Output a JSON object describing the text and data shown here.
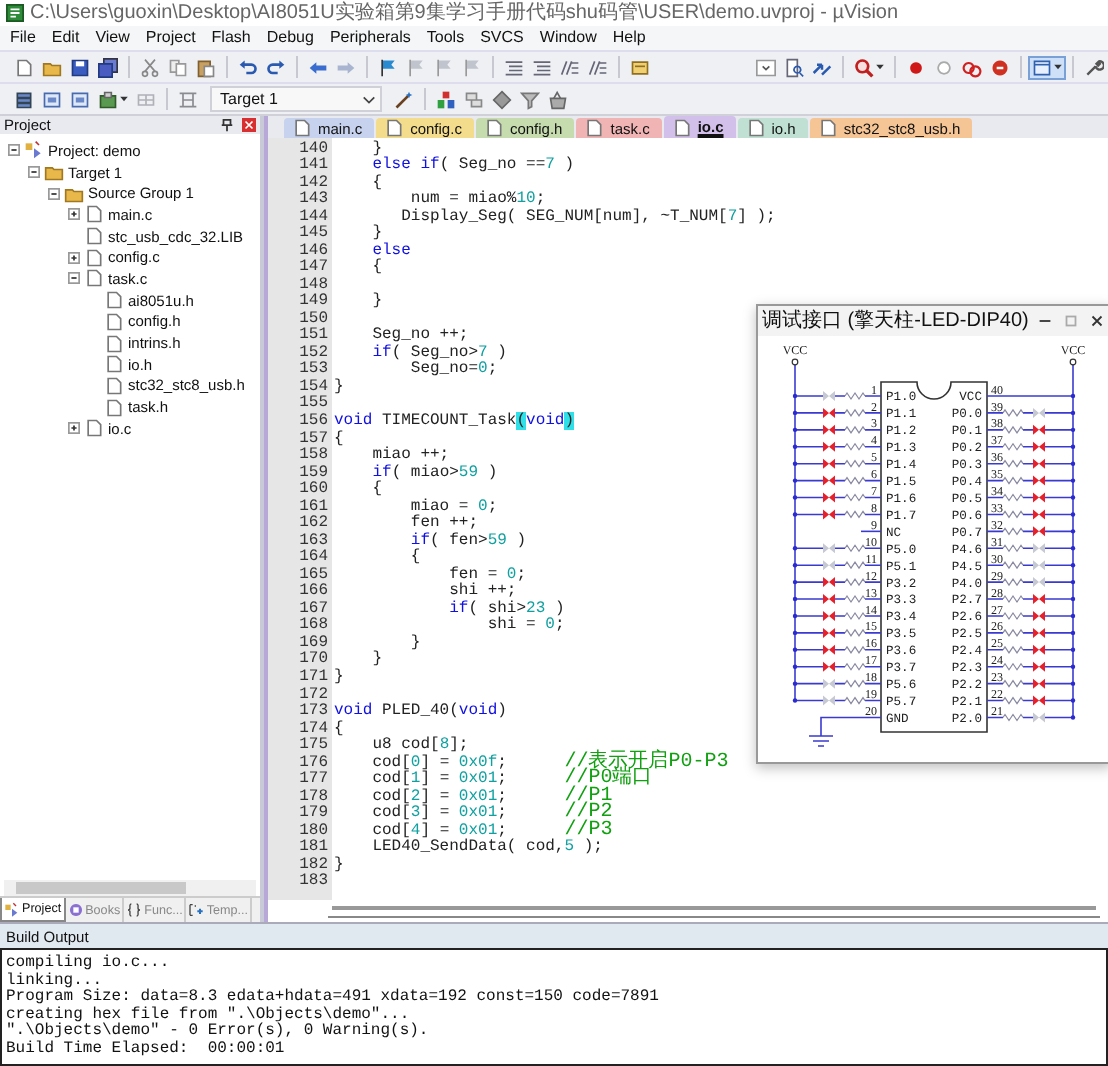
{
  "window": {
    "title": "C:\\Users\\guoxin\\Desktop\\AI8051U实验箱第9集学习手册代码shu码管\\USER\\demo.uvproj - µVision"
  },
  "menu": [
    "File",
    "Edit",
    "View",
    "Project",
    "Flash",
    "Debug",
    "Peripherals",
    "Tools",
    "SVCS",
    "Window",
    "Help"
  ],
  "target_select": {
    "value": "Target 1"
  },
  "project": {
    "title": "Project",
    "tree": [
      {
        "label": "Project: demo",
        "kind": "project",
        "expanded": true,
        "children": [
          {
            "label": "Target 1",
            "kind": "target",
            "expanded": true,
            "children": [
              {
                "label": "Source Group 1",
                "kind": "group",
                "expanded": true,
                "children": [
                  {
                    "label": "main.c",
                    "kind": "file",
                    "expanded": false
                  },
                  {
                    "label": "stc_usb_cdc_32.LIB",
                    "kind": "file"
                  },
                  {
                    "label": "config.c",
                    "kind": "file",
                    "expanded": false
                  },
                  {
                    "label": "task.c",
                    "kind": "file",
                    "expanded": true,
                    "children": [
                      {
                        "label": "ai8051u.h",
                        "kind": "file"
                      },
                      {
                        "label": "config.h",
                        "kind": "file"
                      },
                      {
                        "label": "intrins.h",
                        "kind": "file"
                      },
                      {
                        "label": "io.h",
                        "kind": "file"
                      },
                      {
                        "label": "stc32_stc8_usb.h",
                        "kind": "file"
                      },
                      {
                        "label": "task.h",
                        "kind": "file"
                      }
                    ]
                  },
                  {
                    "label": "io.c",
                    "kind": "file",
                    "expanded": false
                  }
                ]
              }
            ]
          }
        ]
      }
    ],
    "panel_tabs": [
      {
        "label": "Project",
        "kind": "project",
        "selected": true
      },
      {
        "label": "Books",
        "kind": "books",
        "selected": false
      },
      {
        "label": "Func...",
        "kind": "functions",
        "selected": false
      },
      {
        "label": "Temp...",
        "kind": "templates",
        "selected": false
      }
    ]
  },
  "editor": {
    "tabs": [
      {
        "label": "main.c",
        "color": "#c6d2ee",
        "selected": false
      },
      {
        "label": "config.c",
        "color": "#f3dc8c",
        "selected": false
      },
      {
        "label": "config.h",
        "color": "#c6dcae",
        "selected": false
      },
      {
        "label": "task.c",
        "color": "#f0b4b4",
        "selected": false
      },
      {
        "label": "io.c",
        "color": "#d2c0ea",
        "selected": true
      },
      {
        "label": "io.h",
        "color": "#bfe0d2",
        "selected": false
      },
      {
        "label": "stc32_stc8_usb.h",
        "color": "#f6c595",
        "selected": false
      }
    ],
    "lines": [
      {
        "number": "140",
        "segments": [
          {
            "kind": "plain",
            "text": "    }"
          }
        ]
      },
      {
        "number": "141",
        "segments": [
          {
            "kind": "keyword",
            "text": "    else if"
          },
          {
            "kind": "plain",
            "text": "( Seg_no =="
          },
          {
            "kind": "number",
            "text": "7"
          },
          {
            "kind": "plain",
            "text": " )"
          }
        ]
      },
      {
        "number": "142",
        "segments": [
          {
            "kind": "plain",
            "text": "    {"
          }
        ]
      },
      {
        "number": "143",
        "segments": [
          {
            "kind": "plain",
            "text": "        num = miao%"
          },
          {
            "kind": "number",
            "text": "10"
          },
          {
            "kind": "plain",
            "text": ";"
          }
        ]
      },
      {
        "number": "144",
        "segments": [
          {
            "kind": "plain",
            "text": "       Display_Seg( SEG_NUM[num], ~T_NUM["
          },
          {
            "kind": "number",
            "text": "7"
          },
          {
            "kind": "plain",
            "text": "] );"
          }
        ]
      },
      {
        "number": "145",
        "segments": [
          {
            "kind": "plain",
            "text": "    }"
          }
        ]
      },
      {
        "number": "146",
        "segments": [
          {
            "kind": "keyword",
            "text": "    else"
          }
        ]
      },
      {
        "number": "147",
        "segments": [
          {
            "kind": "plain",
            "text": "    {"
          }
        ]
      },
      {
        "number": "148"
      },
      {
        "number": "149",
        "segments": [
          {
            "kind": "plain",
            "text": "    }"
          }
        ]
      },
      {
        "number": "150"
      },
      {
        "number": "151",
        "segments": [
          {
            "kind": "plain",
            "text": "    Seg_no ++;"
          }
        ]
      },
      {
        "number": "152",
        "segments": [
          {
            "kind": "keyword",
            "text": "    if"
          },
          {
            "kind": "plain",
            "text": "( Seg_no>"
          },
          {
            "kind": "number",
            "text": "7"
          },
          {
            "kind": "plain",
            "text": " )"
          }
        ]
      },
      {
        "number": "153",
        "segments": [
          {
            "kind": "plain",
            "text": "        Seg_no="
          },
          {
            "kind": "number",
            "text": "0"
          },
          {
            "kind": "plain",
            "text": ";"
          }
        ]
      },
      {
        "number": "154",
        "segments": [
          {
            "kind": "plain",
            "text": "}"
          }
        ]
      },
      {
        "number": "155"
      },
      {
        "number": "156",
        "segments": [
          {
            "kind": "keyword",
            "text": "void"
          },
          {
            "kind": "plain",
            "text": " TIMECOUNT_Task"
          },
          {
            "kind": "match",
            "text": "("
          },
          {
            "kind": "keyword",
            "text": "void"
          },
          {
            "kind": "match",
            "text": ")"
          }
        ]
      },
      {
        "number": "157",
        "segments": [
          {
            "kind": "plain",
            "text": "{"
          }
        ]
      },
      {
        "number": "158",
        "segments": [
          {
            "kind": "plain",
            "text": "    miao ++;"
          }
        ]
      },
      {
        "number": "159",
        "segments": [
          {
            "kind": "keyword",
            "text": "    if"
          },
          {
            "kind": "plain",
            "text": "( miao>"
          },
          {
            "kind": "number",
            "text": "59"
          },
          {
            "kind": "plain",
            "text": " )"
          }
        ]
      },
      {
        "number": "160",
        "segments": [
          {
            "kind": "plain",
            "text": "    {"
          }
        ]
      },
      {
        "number": "161",
        "segments": [
          {
            "kind": "plain",
            "text": "        miao = "
          },
          {
            "kind": "number",
            "text": "0"
          },
          {
            "kind": "plain",
            "text": ";"
          }
        ]
      },
      {
        "number": "162",
        "segments": [
          {
            "kind": "plain",
            "text": "        fen ++;"
          }
        ]
      },
      {
        "number": "163",
        "segments": [
          {
            "kind": "keyword",
            "text": "        if"
          },
          {
            "kind": "plain",
            "text": "( fen>"
          },
          {
            "kind": "number",
            "text": "59"
          },
          {
            "kind": "plain",
            "text": " )"
          }
        ]
      },
      {
        "number": "164",
        "segments": [
          {
            "kind": "plain",
            "text": "        {"
          }
        ]
      },
      {
        "number": "165",
        "segments": [
          {
            "kind": "plain",
            "text": "            fen = "
          },
          {
            "kind": "number",
            "text": "0"
          },
          {
            "kind": "plain",
            "text": ";"
          }
        ]
      },
      {
        "number": "166",
        "segments": [
          {
            "kind": "plain",
            "text": "            shi ++;"
          }
        ]
      },
      {
        "number": "167",
        "segments": [
          {
            "kind": "keyword",
            "text": "            if"
          },
          {
            "kind": "plain",
            "text": "( shi>"
          },
          {
            "kind": "number",
            "text": "23"
          },
          {
            "kind": "plain",
            "text": " )"
          }
        ]
      },
      {
        "number": "168",
        "segments": [
          {
            "kind": "plain",
            "text": "                shi = "
          },
          {
            "kind": "number",
            "text": "0"
          },
          {
            "kind": "plain",
            "text": ";"
          }
        ]
      },
      {
        "number": "169",
        "segments": [
          {
            "kind": "plain",
            "text": "        }"
          }
        ]
      },
      {
        "number": "170",
        "segments": [
          {
            "kind": "plain",
            "text": "    }"
          }
        ]
      },
      {
        "number": "171",
        "segments": [
          {
            "kind": "plain",
            "text": "}"
          }
        ]
      },
      {
        "number": "172"
      },
      {
        "number": "173",
        "segments": [
          {
            "kind": "keyword",
            "text": "void"
          },
          {
            "kind": "plain",
            "text": " PLED_40("
          },
          {
            "kind": "keyword",
            "text": "void"
          },
          {
            "kind": "plain",
            "text": ")"
          }
        ]
      },
      {
        "number": "174",
        "segments": [
          {
            "kind": "plain",
            "text": "{"
          }
        ]
      },
      {
        "number": "175",
        "segments": [
          {
            "kind": "plain",
            "text": "    u8 cod["
          },
          {
            "kind": "number",
            "text": "8"
          },
          {
            "kind": "plain",
            "text": "];"
          }
        ]
      },
      {
        "number": "176",
        "segments": [
          {
            "kind": "plain",
            "text": "    cod["
          },
          {
            "kind": "number",
            "text": "0"
          },
          {
            "kind": "plain",
            "text": "] = "
          },
          {
            "kind": "number",
            "text": "0x0f"
          },
          {
            "kind": "plain",
            "text": ";      "
          },
          {
            "kind": "comment",
            "text": "//表示开启P0-P3"
          }
        ]
      },
      {
        "number": "177",
        "segments": [
          {
            "kind": "plain",
            "text": "    cod["
          },
          {
            "kind": "number",
            "text": "1"
          },
          {
            "kind": "plain",
            "text": "] = "
          },
          {
            "kind": "number",
            "text": "0x01"
          },
          {
            "kind": "plain",
            "text": ";      "
          },
          {
            "kind": "comment",
            "text": "//P0端口"
          }
        ]
      },
      {
        "number": "178",
        "segments": [
          {
            "kind": "plain",
            "text": "    cod["
          },
          {
            "kind": "number",
            "text": "2"
          },
          {
            "kind": "plain",
            "text": "] = "
          },
          {
            "kind": "number",
            "text": "0x01"
          },
          {
            "kind": "plain",
            "text": ";      "
          },
          {
            "kind": "comment",
            "text": "//P1"
          }
        ]
      },
      {
        "number": "179",
        "segments": [
          {
            "kind": "plain",
            "text": "    cod["
          },
          {
            "kind": "number",
            "text": "3"
          },
          {
            "kind": "plain",
            "text": "] = "
          },
          {
            "kind": "number",
            "text": "0x01"
          },
          {
            "kind": "plain",
            "text": ";      "
          },
          {
            "kind": "comment",
            "text": "//P2"
          }
        ]
      },
      {
        "number": "180",
        "segments": [
          {
            "kind": "plain",
            "text": "    cod["
          },
          {
            "kind": "number",
            "text": "4"
          },
          {
            "kind": "plain",
            "text": "] = "
          },
          {
            "kind": "number",
            "text": "0x01"
          },
          {
            "kind": "plain",
            "text": ";      "
          },
          {
            "kind": "comment",
            "text": "//P3"
          }
        ]
      },
      {
        "number": "181",
        "segments": [
          {
            "kind": "plain",
            "text": "    LED40_SendData( cod,"
          },
          {
            "kind": "number",
            "text": "5"
          },
          {
            "kind": "plain",
            "text": " );"
          }
        ]
      },
      {
        "number": "182",
        "segments": [
          {
            "kind": "plain",
            "text": "}"
          }
        ]
      },
      {
        "number": "183"
      }
    ]
  },
  "debug_window": {
    "title": "调试接口 (擎天柱-LED-DIP40)",
    "supply_labels": [
      "VCC",
      "VCC"
    ],
    "left_pins": [
      {
        "number": "1",
        "label": "P1.0",
        "kind": "led",
        "lit": false
      },
      {
        "number": "2",
        "label": "P1.1",
        "kind": "led",
        "lit": true
      },
      {
        "number": "3",
        "label": "P1.2",
        "kind": "led",
        "lit": true
      },
      {
        "number": "4",
        "label": "P1.3",
        "kind": "led",
        "lit": true
      },
      {
        "number": "5",
        "label": "P1.4",
        "kind": "led",
        "lit": true
      },
      {
        "number": "6",
        "label": "P1.5",
        "kind": "led",
        "lit": true
      },
      {
        "number": "7",
        "label": "P1.6",
        "kind": "led",
        "lit": true
      },
      {
        "number": "8",
        "label": "P1.7",
        "kind": "led",
        "lit": true
      },
      {
        "number": "9",
        "label": "NC",
        "kind": "plain"
      },
      {
        "number": "10",
        "label": "P5.0",
        "kind": "led",
        "lit": false
      },
      {
        "number": "11",
        "label": "P5.1",
        "kind": "led",
        "lit": false
      },
      {
        "number": "12",
        "label": "P3.2",
        "kind": "led",
        "lit": true
      },
      {
        "number": "13",
        "label": "P3.3",
        "kind": "led",
        "lit": true
      },
      {
        "number": "14",
        "label": "P3.4",
        "kind": "led",
        "lit": true
      },
      {
        "number": "15",
        "label": "P3.5",
        "kind": "led",
        "lit": true
      },
      {
        "number": "16",
        "label": "P3.6",
        "kind": "led",
        "lit": true
      },
      {
        "number": "17",
        "label": "P3.7",
        "kind": "led",
        "lit": true
      },
      {
        "number": "18",
        "label": "P5.6",
        "kind": "led",
        "lit": false
      },
      {
        "number": "19",
        "label": "P5.7",
        "kind": "led",
        "lit": false
      },
      {
        "number": "20",
        "label": "GND",
        "kind": "ground"
      }
    ],
    "right_pins": [
      {
        "number": "40",
        "label": "VCC",
        "kind": "supply"
      },
      {
        "number": "39",
        "label": "P0.0",
        "kind": "led",
        "lit": false
      },
      {
        "number": "38",
        "label": "P0.1",
        "kind": "led",
        "lit": true
      },
      {
        "number": "37",
        "label": "P0.2",
        "kind": "led",
        "lit": true
      },
      {
        "number": "36",
        "label": "P0.3",
        "kind": "led",
        "lit": true
      },
      {
        "number": "35",
        "label": "P0.4",
        "kind": "led",
        "lit": true
      },
      {
        "number": "34",
        "label": "P0.5",
        "kind": "led",
        "lit": true
      },
      {
        "number": "33",
        "label": "P0.6",
        "kind": "led",
        "lit": true
      },
      {
        "number": "32",
        "label": "P0.7",
        "kind": "led",
        "lit": true
      },
      {
        "number": "31",
        "label": "P4.6",
        "kind": "led",
        "lit": false
      },
      {
        "number": "30",
        "label": "P4.5",
        "kind": "led",
        "lit": false
      },
      {
        "number": "29",
        "label": "P4.0",
        "kind": "led",
        "lit": false
      },
      {
        "number": "28",
        "label": "P2.7",
        "kind": "led",
        "lit": true
      },
      {
        "number": "27",
        "label": "P2.6",
        "kind": "led",
        "lit": true
      },
      {
        "number": "26",
        "label": "P2.5",
        "kind": "led",
        "lit": true
      },
      {
        "number": "25",
        "label": "P2.4",
        "kind": "led",
        "lit": true
      },
      {
        "number": "24",
        "label": "P2.3",
        "kind": "led",
        "lit": true
      },
      {
        "number": "23",
        "label": "P2.2",
        "kind": "led",
        "lit": true
      },
      {
        "number": "22",
        "label": "P2.1",
        "kind": "led",
        "lit": true
      },
      {
        "number": "21",
        "label": "P2.0",
        "kind": "led",
        "lit": false
      }
    ]
  },
  "build_output": {
    "title": "Build Output",
    "lines": [
      "compiling io.c...",
      "linking...",
      "Program Size: data=8.3 edata+hdata=491 xdata=192 const=150 code=7891",
      "creating hex file from \".\\Objects\\demo\"...",
      "\".\\Objects\\demo\" - 0 Error(s), 0 Warning(s).",
      "Build Time Elapsed:  00:00:01"
    ]
  }
}
